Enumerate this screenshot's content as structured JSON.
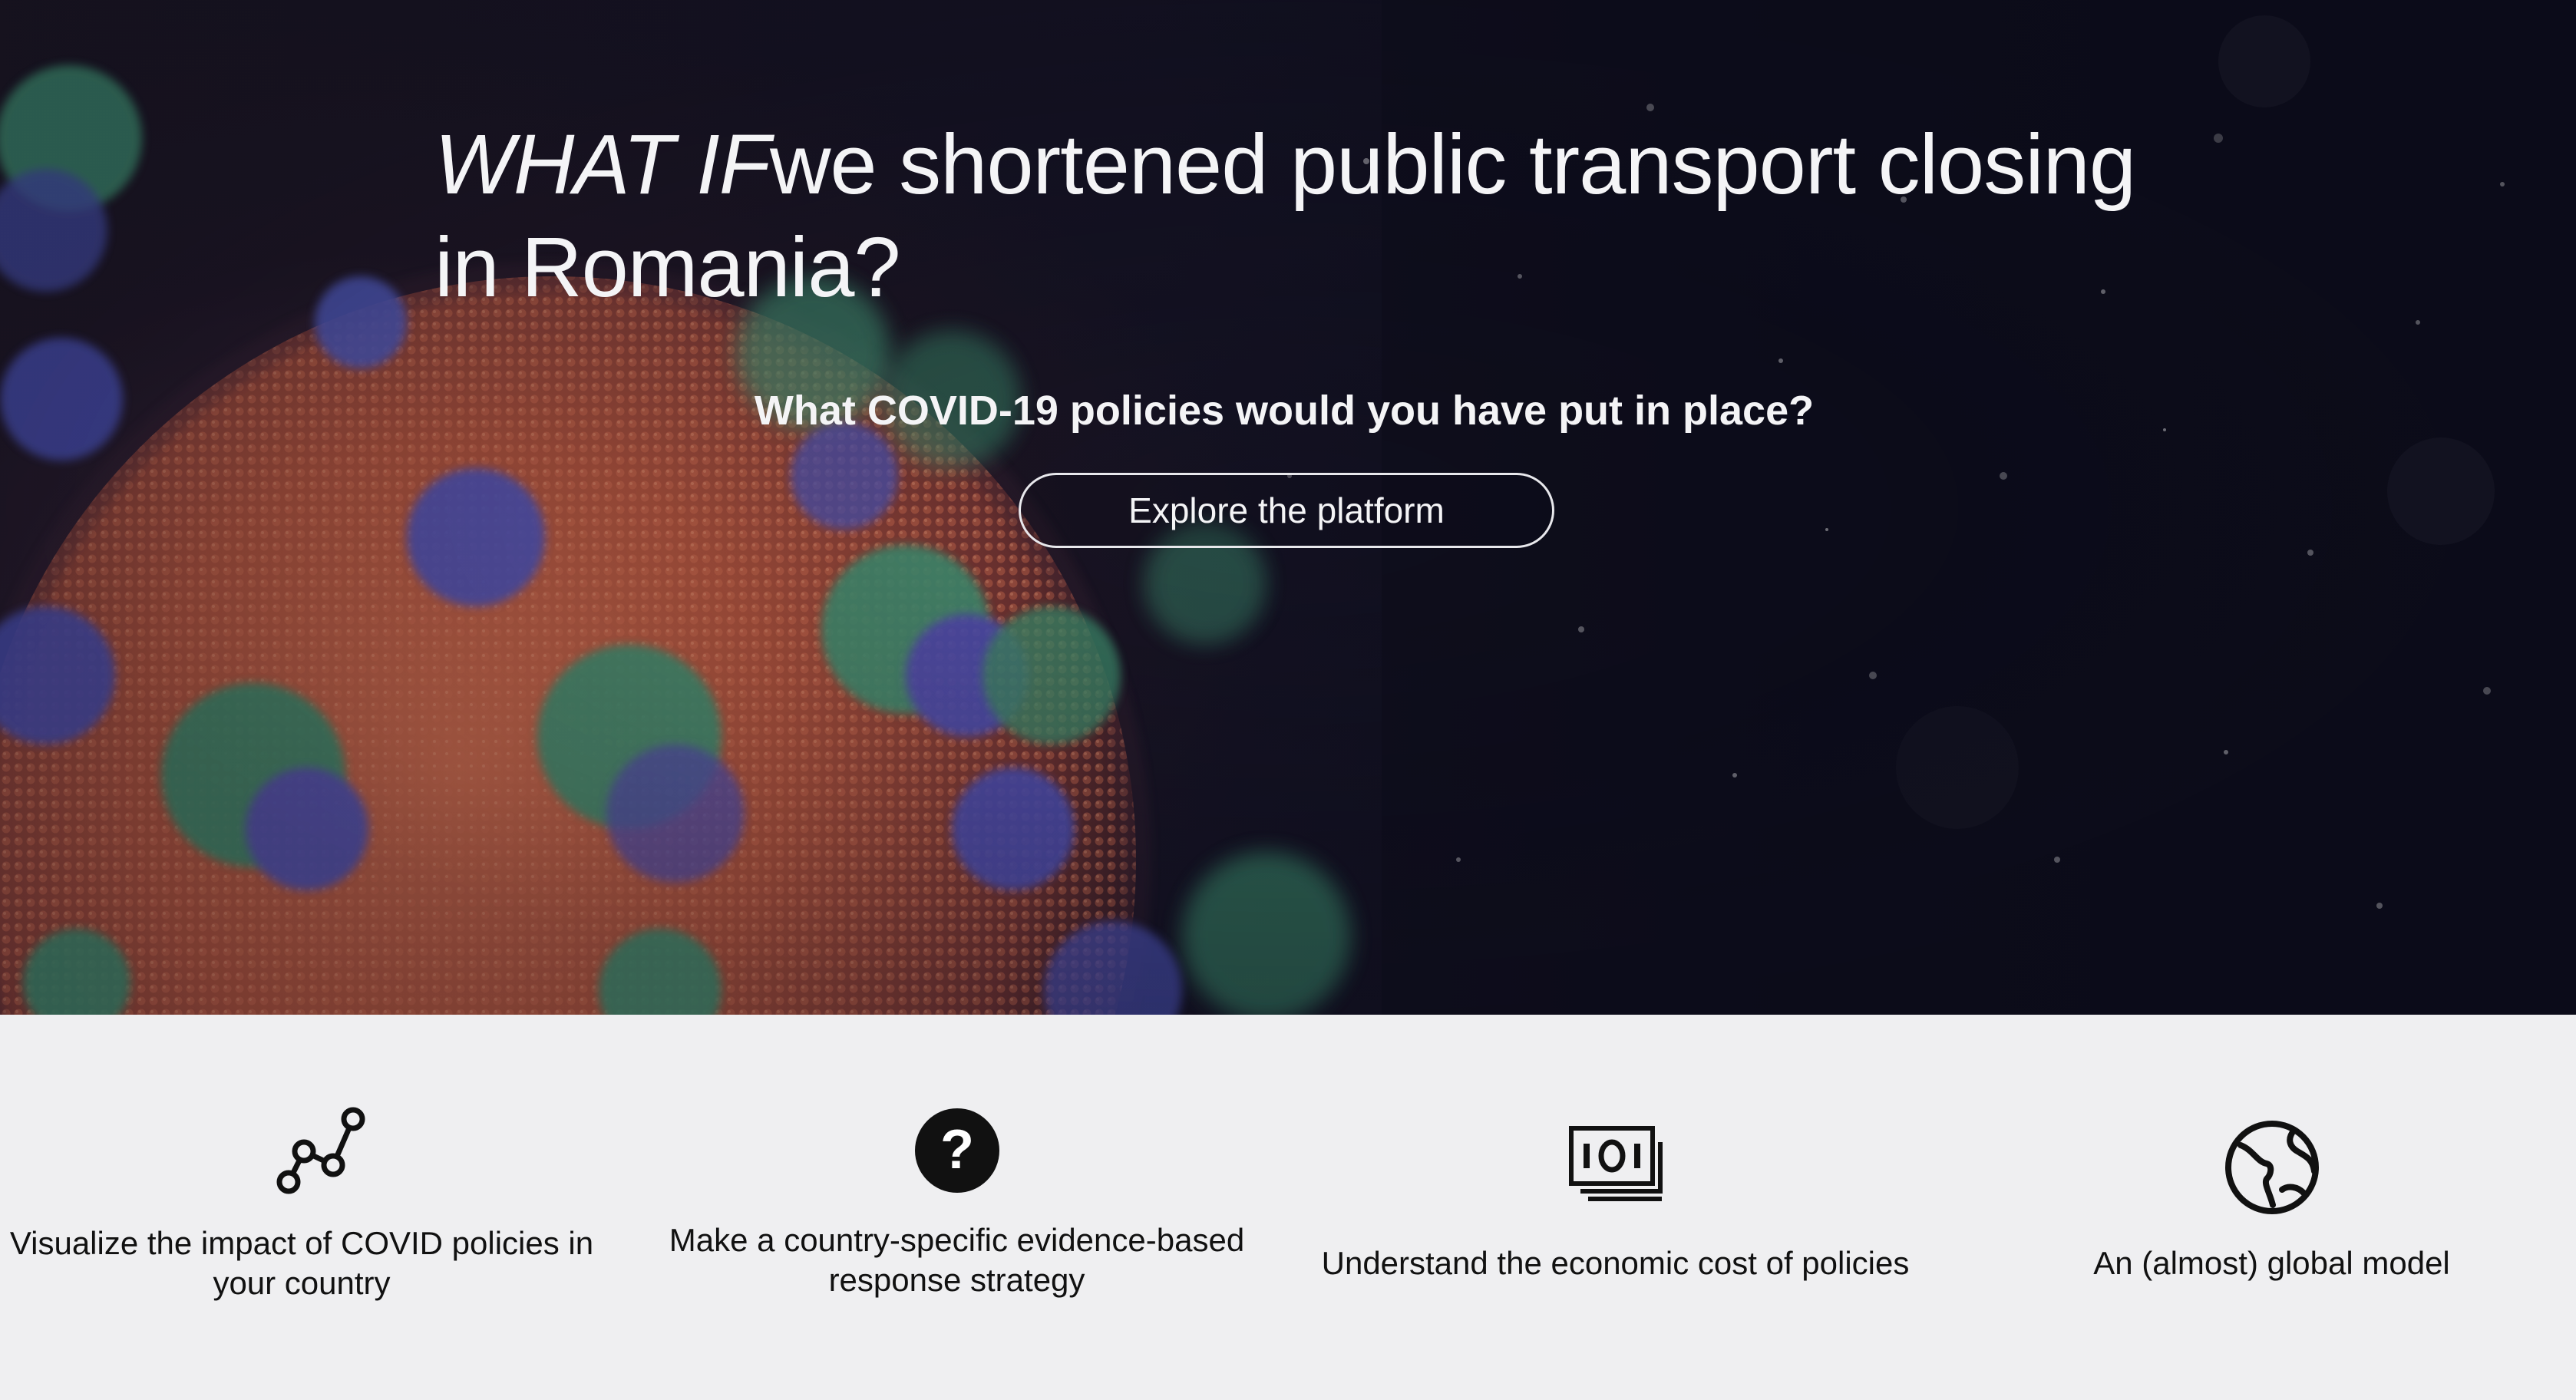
{
  "hero": {
    "title_lead": "WHAT IF",
    "title_rest": "we shortened public transport closing in Romania?",
    "subtitle": "What COVID-19 policies would you have put in place?",
    "cta_label": "Explore the platform"
  },
  "features": [
    {
      "icon": "line-chart-icon",
      "label": "Visualize the impact of COVID policies in your country"
    },
    {
      "icon": "question-circle-icon",
      "label": "Make a country-specific evidence-based response strategy"
    },
    {
      "icon": "money-stack-icon",
      "label": "Understand the economic cost of policies"
    },
    {
      "icon": "globe-icon",
      "label": "An (almost) global model"
    }
  ],
  "colors": {
    "hero_text": "#f4f4f6",
    "feature_bg": "#efeff1",
    "feature_text": "#111111",
    "virus_body": "#b0553c",
    "spike_green": "#3f8f6f",
    "spike_blue": "#4a4fb0"
  }
}
